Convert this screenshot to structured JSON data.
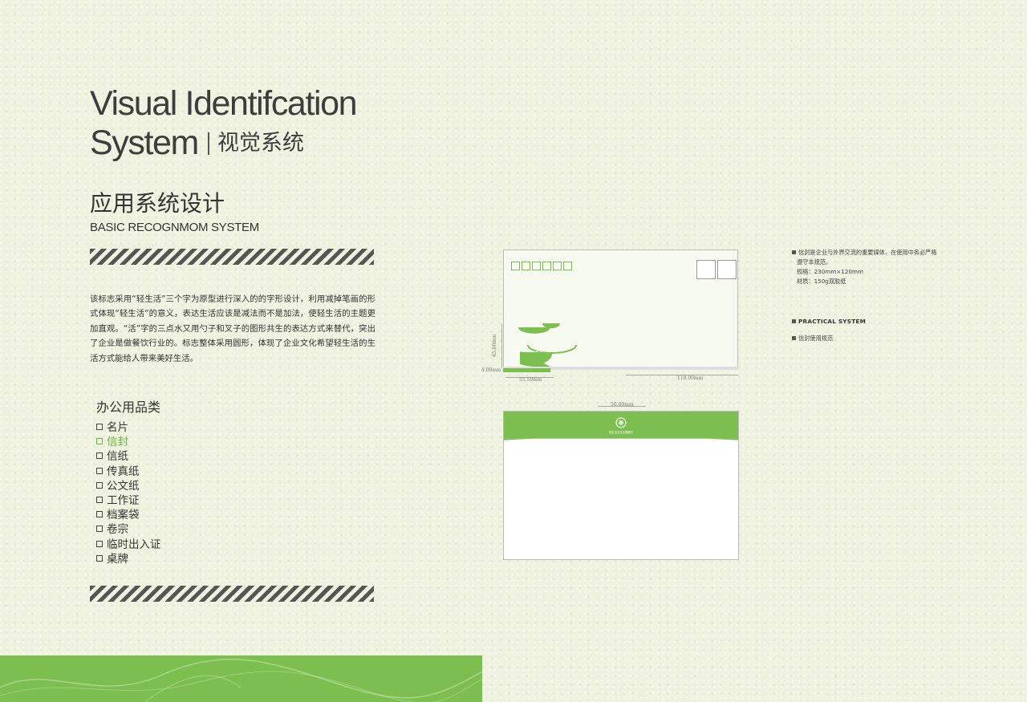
{
  "header": {
    "title_line1": "Visual Identifcation",
    "title_line2_en": "System",
    "title_line2_cn": "视觉系统"
  },
  "section": {
    "title_cn": "应用系统设计",
    "title_en": "BASIC RECOGNMOM SYSTEM"
  },
  "description": "该标志采用“轻生活”三个字为原型进行深入的的字形设计，利用减掉笔画的形式体现“轻生活”的意义，表达生活应该是减法而不是加法，使轻生活的主题更加直观。“活”字的三点水又用勺子和叉子的图形共生的表达方式来替代，突出了企业是做餐饮行业的。标志整体采用圆形，体现了企业文化希望轻生活的生活方式能给人带来美好生活。",
  "categories": {
    "title": "办公用品类",
    "items": [
      {
        "label": "名片",
        "active": false
      },
      {
        "label": "信封",
        "active": true
      },
      {
        "label": "信纸",
        "active": false
      },
      {
        "label": "传真纸",
        "active": false
      },
      {
        "label": "公文纸",
        "active": false
      },
      {
        "label": "工作证",
        "active": false
      },
      {
        "label": "档案袋",
        "active": false
      },
      {
        "label": "卷宗",
        "active": false
      },
      {
        "label": "临时出入证",
        "active": false
      },
      {
        "label": "桌牌",
        "active": false
      }
    ]
  },
  "envelope": {
    "dim_height_left": "4.00mm",
    "dim_logo_width": "55.50mm",
    "dim_right_width": "110.00mm",
    "dim_logo_height": "45.00mm",
    "dim_flap": "50.00mm",
    "flap_text": "轻生活文化主题餐厅"
  },
  "notes": {
    "line1": "信封是企业与外界交流的重要媒体，在使用中务必严格",
    "line2": "遵守本规范。",
    "line3": "规格：230mm×120mm",
    "line4": "材质：150g双胶纸",
    "practical": "PRACTICAL SYSTEM",
    "usage": "信封使用规范"
  },
  "colors": {
    "accent_green": "#7dbe51",
    "background": "#eef2df",
    "text": "#3a3a3a"
  }
}
